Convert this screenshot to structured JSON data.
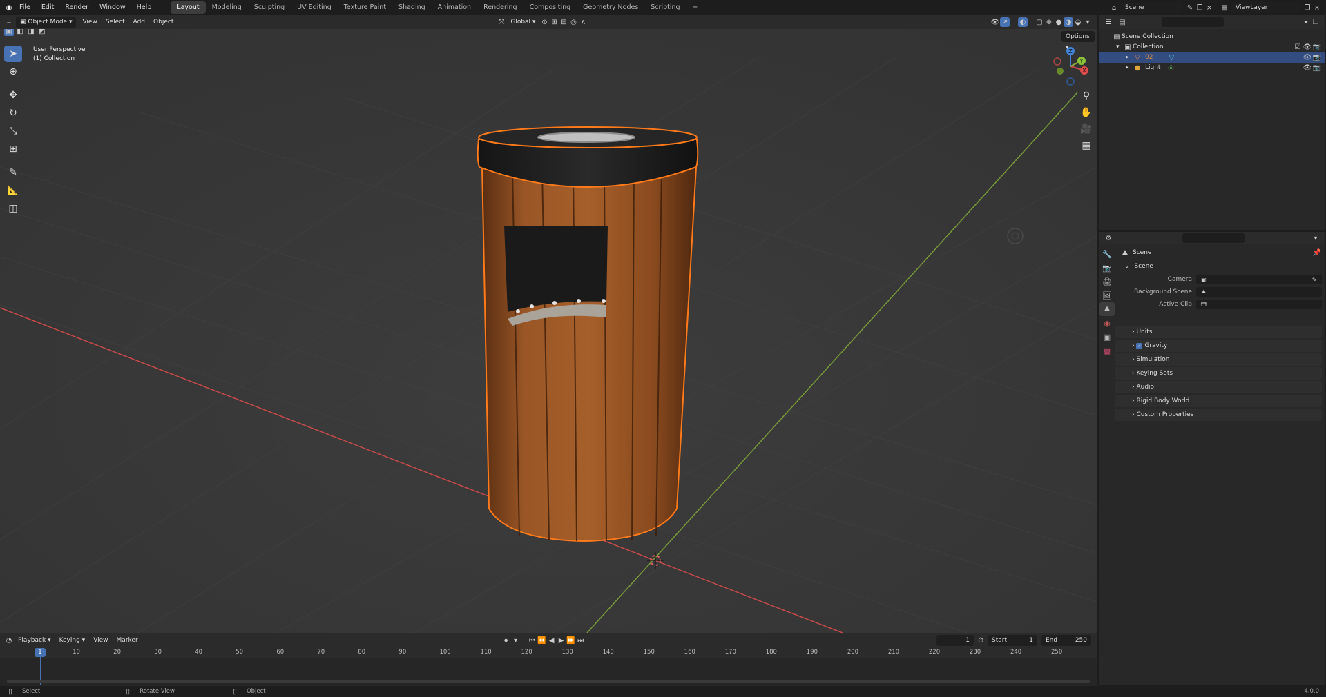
{
  "menu": {
    "items": [
      "File",
      "Edit",
      "Render",
      "Window",
      "Help"
    ],
    "workspaces": [
      "Layout",
      "Modeling",
      "Sculpting",
      "UV Editing",
      "Texture Paint",
      "Shading",
      "Animation",
      "Rendering",
      "Compositing",
      "Geometry Nodes",
      "Scripting"
    ],
    "add_tab": "+",
    "scene": "Scene",
    "view_layer": "ViewLayer"
  },
  "viewport": {
    "mode": "Object Mode",
    "menus": [
      "View",
      "Select",
      "Add",
      "Object"
    ],
    "orientation": "Global",
    "options": "Options",
    "overlay_title": "User Perspective",
    "overlay_collection": "(1) Collection",
    "gizmo_axes": [
      "X",
      "Y",
      "Z"
    ]
  },
  "outliner": {
    "root": "Scene Collection",
    "collection": "Collection",
    "items": [
      {
        "name": "02",
        "selected": true,
        "color": "#e08a3c"
      },
      {
        "name": "Light",
        "selected": false,
        "color": "#e0a43c"
      }
    ]
  },
  "properties": {
    "context": "Scene",
    "panel": "Scene",
    "fields": [
      {
        "label": "Camera"
      },
      {
        "label": "Background Scene"
      },
      {
        "label": "Active Clip"
      }
    ],
    "groups": [
      "Units",
      "Gravity",
      "Simulation",
      "Keying Sets",
      "Audio",
      "Rigid Body World",
      "Custom Properties"
    ],
    "gravity_checked": true
  },
  "timeline": {
    "menus": [
      "Playback",
      "Keying",
      "View",
      "Marker"
    ],
    "current_frame": "1",
    "start_label": "Start",
    "start": "1",
    "end_label": "End",
    "end": "250",
    "ticks": [
      "1",
      "10",
      "20",
      "30",
      "40",
      "50",
      "60",
      "70",
      "80",
      "90",
      "100",
      "110",
      "120",
      "130",
      "140",
      "150",
      "160",
      "170",
      "180",
      "190",
      "200",
      "210",
      "220",
      "230",
      "240",
      "250"
    ]
  },
  "status": {
    "items": [
      "Select",
      "Rotate View",
      "Object"
    ],
    "version": "4.0.0"
  },
  "colors": {
    "accent": "#4772b3",
    "selection_outline": "#ff7a1a",
    "x_axis": "#c94a4a",
    "y_axis": "#7a9a3a"
  }
}
